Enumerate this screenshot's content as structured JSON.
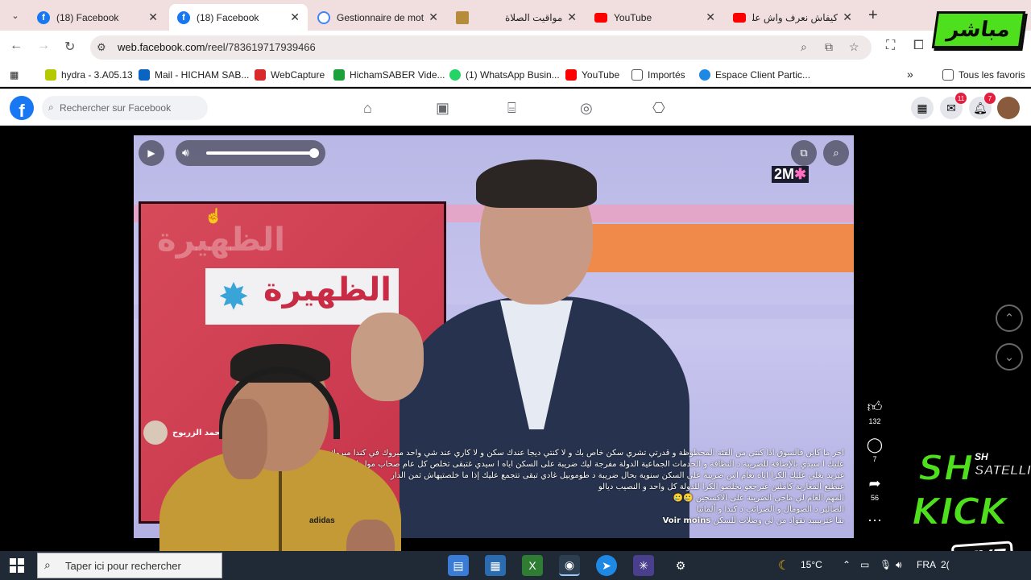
{
  "browser": {
    "tabs": [
      {
        "title": "(18) Facebook",
        "icon": "facebook-icon",
        "active": false
      },
      {
        "title": "(18) Facebook",
        "icon": "facebook-icon",
        "active": true
      },
      {
        "title": "Gestionnaire de mots",
        "icon": "google-icon",
        "active": false
      },
      {
        "title": "مواقيت الصلاة",
        "icon": "prayer-times-icon",
        "active": false
      },
      {
        "title": "YouTube",
        "icon": "youtube-icon",
        "active": false
      },
      {
        "title": "كيفاش نعرف واش علة",
        "icon": "youtube-icon",
        "active": false
      }
    ],
    "url_host": "web.facebook.com",
    "url_path": "/reel/783619717939466",
    "bookmarks": [
      {
        "label": "hydra - 3.A05.13"
      },
      {
        "label": "Mail - HICHAM SAB..."
      },
      {
        "label": "WebCapture"
      },
      {
        "label": "HichamSABER Vide..."
      },
      {
        "label": "(1) WhatsApp Busin..."
      },
      {
        "label": "YouTube"
      },
      {
        "label": "Importés"
      },
      {
        "label": "Espace Client Partic..."
      }
    ],
    "bookmarks_overflow": "»",
    "all_favorites": "Tous les favoris"
  },
  "facebook": {
    "search_placeholder": "Rechercher sur Facebook",
    "messenger_badge": "11",
    "notifications_badge": "7"
  },
  "reel": {
    "author": "محمد الزريوح",
    "caption_lines": [
      "اخر ما كاين فالسوق اذا كنتي من الفئة المحظوظة و قدرتي تشري سكن خاص بك و لا كنتي ديجا عندك سكن و لا كاري عند شي واحد مبروك في كندا مبروك",
      "عليك ا سيدي بالإضافة للضريبة د النظافة و الخدمات الجماعية الدولة مفرجة ليك ضريبة على السكن اياه ا سيدي غتبقى تخلص كل عام صحاب مول الدار",
      "غيزيد يغلي عليك الكرا اياه تعام اس ضريبة على السكن سنوية بحال ضريبة د طوموبيل غادي تبقى تتجمع عليك إذا ما خلصتيهاش ثمن الدار",
      "غيطيع المغاربة كاملين غيرجعو يخلصو الكرا للدولة كل واحد و النصيب ديالو",
      "المهم العام لي ماجي الضريبة على الاكسجين 🥲🥲",
      "الصالير د الصومال و الضرائب د كندا و ألمانيا"
    ],
    "caption_last": "بقا غتزبيبيد تقواد من لي وصلات للسكن",
    "see_more": "Voir moins",
    "likes": "132",
    "comments": "7",
    "shares": "56",
    "volume_level": 1.0,
    "channel_logo_main": "2M",
    "channel_logo_accent": "✱",
    "studio_title": "الظهيرة"
  },
  "overlay": {
    "live_logo": "مباشر",
    "sh": "SH",
    "sh_small": "SH",
    "satellite": "SATELLITE",
    "kick": "KICK",
    "live": "LIVE",
    "shirt_brand": "adidas"
  },
  "taskbar": {
    "search_placeholder": "Taper ici pour rechercher",
    "weather": "15°C",
    "language": "FRA",
    "clock_partial": "2("
  },
  "colors": {
    "facebook_blue": "#1877f2",
    "badge_red": "#e41e3f",
    "kick_green": "#4fe01d"
  }
}
